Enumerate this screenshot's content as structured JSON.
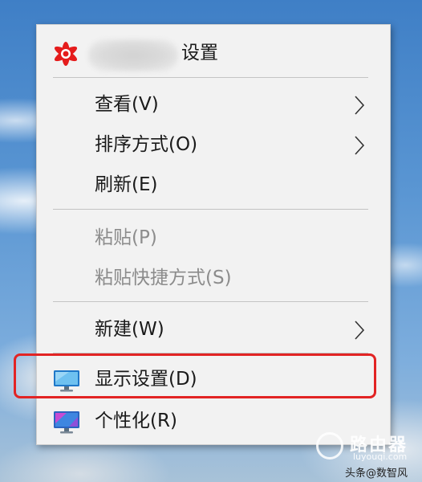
{
  "menu": {
    "header": {
      "app_name_hidden": true,
      "label": "设置",
      "icon": "red-star-logo-icon"
    },
    "items": [
      {
        "label": "查看(V)",
        "has_submenu": true,
        "enabled": true
      },
      {
        "label": "排序方式(O)",
        "has_submenu": true,
        "enabled": true
      },
      {
        "label": "刷新(E)",
        "has_submenu": false,
        "enabled": true
      },
      {
        "label": "粘贴(P)",
        "has_submenu": false,
        "enabled": false
      },
      {
        "label": "粘贴快捷方式(S)",
        "has_submenu": false,
        "enabled": false
      },
      {
        "label": "新建(W)",
        "has_submenu": true,
        "enabled": true
      },
      {
        "label": "显示设置(D)",
        "has_submenu": false,
        "enabled": true,
        "icon": "display-monitor-icon",
        "highlighted": true
      },
      {
        "label": "个性化(R)",
        "has_submenu": false,
        "enabled": true,
        "icon": "personalize-monitor-icon"
      }
    ]
  },
  "watermark": {
    "brand": "路由器",
    "url": "luyouqi.com",
    "credit": "头条@数智风"
  },
  "colors": {
    "menu_bg": "#f2f2f2",
    "highlight_border": "#e22424",
    "disabled_text": "#8c8c8c"
  }
}
